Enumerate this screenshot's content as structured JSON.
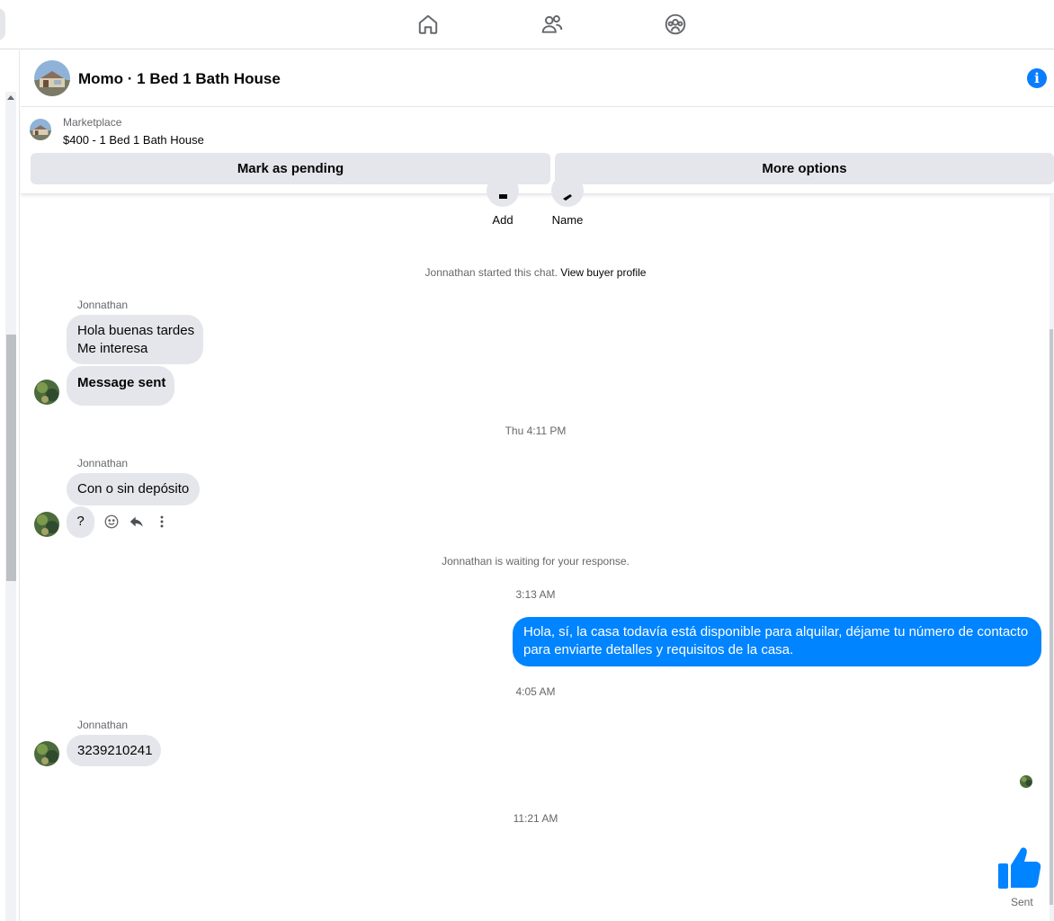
{
  "nav": {
    "icons": [
      "home-icon",
      "friends-icon",
      "groups-icon"
    ]
  },
  "header": {
    "title": "Momo · 1 Bed 1 Bath House"
  },
  "marketplace": {
    "label": "Marketplace",
    "listing": "$400 - 1 Bed 1 Bath House",
    "mark_pending": "Mark as pending",
    "more_options": "More options"
  },
  "profile_actions": {
    "add": "Add",
    "name": "Name"
  },
  "chat": {
    "started_text": "Jonnathan started this chat.",
    "view_buyer_profile": "View buyer profile",
    "messages": [
      {
        "sender": "Jonnathan",
        "lines": [
          "Hola buenas tardes",
          "Me interesa"
        ]
      },
      {
        "text": "Message sent"
      },
      {
        "timestamp": "Thu 4:11 PM"
      },
      {
        "sender": "Jonnathan",
        "text": "Con o sin depósito"
      },
      {
        "text": "?"
      },
      {
        "status": "Jonnathan is waiting for your response."
      },
      {
        "timestamp": "3:13 AM"
      },
      {
        "outgoing": "Hola, sí, la casa todavía está disponible para alquilar, déjame tu número de contacto para enviarte detalles y requisitos de la casa."
      },
      {
        "timestamp": "4:05 AM"
      },
      {
        "sender": "Jonnathan",
        "text": "3239210241"
      },
      {
        "timestamp": "11:21 AM"
      }
    ],
    "sent_label": "Sent"
  },
  "colors": {
    "accent": "#0084ff",
    "incoming_bubble": "#e4e6eb",
    "info": "#0a7cff"
  }
}
